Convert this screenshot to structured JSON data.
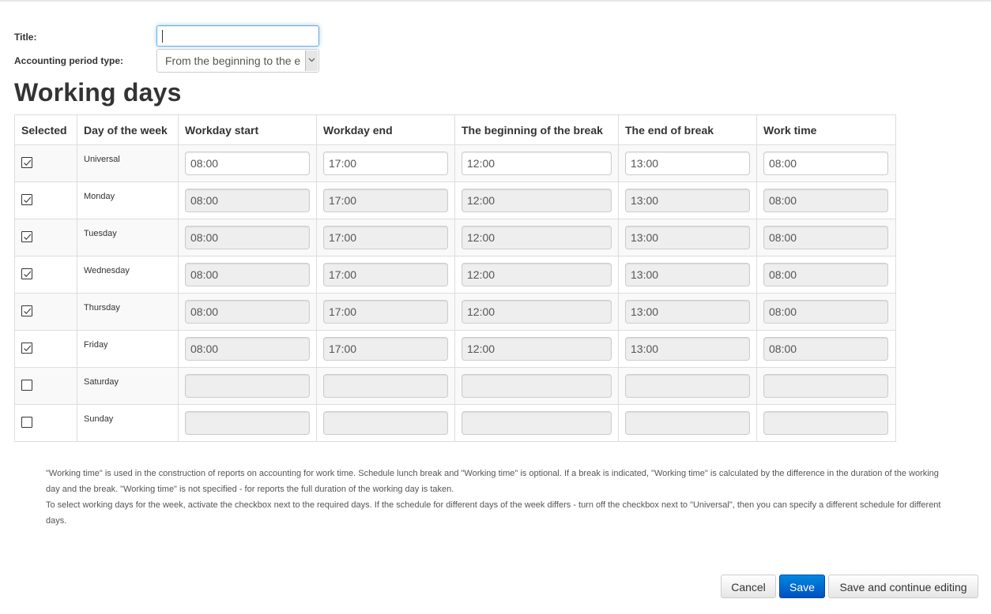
{
  "form": {
    "title_label": "Title:",
    "title_value": "",
    "period_label": "Accounting period type:",
    "period_value": "From the beginning to the end"
  },
  "section_title": "Working days",
  "table": {
    "headers": [
      "Selected",
      "Day of the week",
      "Workday start",
      "Workday end",
      "The beginning of the break",
      "The end of break",
      "Work time"
    ],
    "rows": [
      {
        "day": "Universal",
        "selected": true,
        "editable": true,
        "start": "08:00",
        "end": "17:00",
        "break_start": "12:00",
        "break_end": "13:00",
        "work_time": "08:00"
      },
      {
        "day": "Monday",
        "selected": true,
        "editable": false,
        "start": "08:00",
        "end": "17:00",
        "break_start": "12:00",
        "break_end": "13:00",
        "work_time": "08:00"
      },
      {
        "day": "Tuesday",
        "selected": true,
        "editable": false,
        "start": "08:00",
        "end": "17:00",
        "break_start": "12:00",
        "break_end": "13:00",
        "work_time": "08:00"
      },
      {
        "day": "Wednesday",
        "selected": true,
        "editable": false,
        "start": "08:00",
        "end": "17:00",
        "break_start": "12:00",
        "break_end": "13:00",
        "work_time": "08:00"
      },
      {
        "day": "Thursday",
        "selected": true,
        "editable": false,
        "start": "08:00",
        "end": "17:00",
        "break_start": "12:00",
        "break_end": "13:00",
        "work_time": "08:00"
      },
      {
        "day": "Friday",
        "selected": true,
        "editable": false,
        "start": "08:00",
        "end": "17:00",
        "break_start": "12:00",
        "break_end": "13:00",
        "work_time": "08:00"
      },
      {
        "day": "Saturday",
        "selected": false,
        "editable": false,
        "start": "",
        "end": "",
        "break_start": "",
        "break_end": "",
        "work_time": ""
      },
      {
        "day": "Sunday",
        "selected": false,
        "editable": false,
        "start": "",
        "end": "",
        "break_start": "",
        "break_end": "",
        "work_time": ""
      }
    ]
  },
  "notes": [
    "\"Working time\" is used in the construction of reports on accounting for work time. Schedule lunch break and \"Working time\" is optional. If a break is indicated, \"Working time\" is calculated by the difference in the duration of the working day and the break. \"Working time\" is not specified - for reports the full duration of the working day is taken.",
    "To select working days for the week, activate the checkbox next to the required days. If the schedule for different days of the week differs - turn off the checkbox next to \"Universal\", then you can specify a different schedule for different days."
  ],
  "buttons": {
    "cancel": "Cancel",
    "save": "Save",
    "save_continue": "Save and continue editing"
  },
  "colors": {
    "primary": "#0060d0",
    "focus": "#66afe9"
  },
  "icons": {
    "checkbox_checked": "check-icon",
    "select_arrow": "chevron-down-icon"
  }
}
